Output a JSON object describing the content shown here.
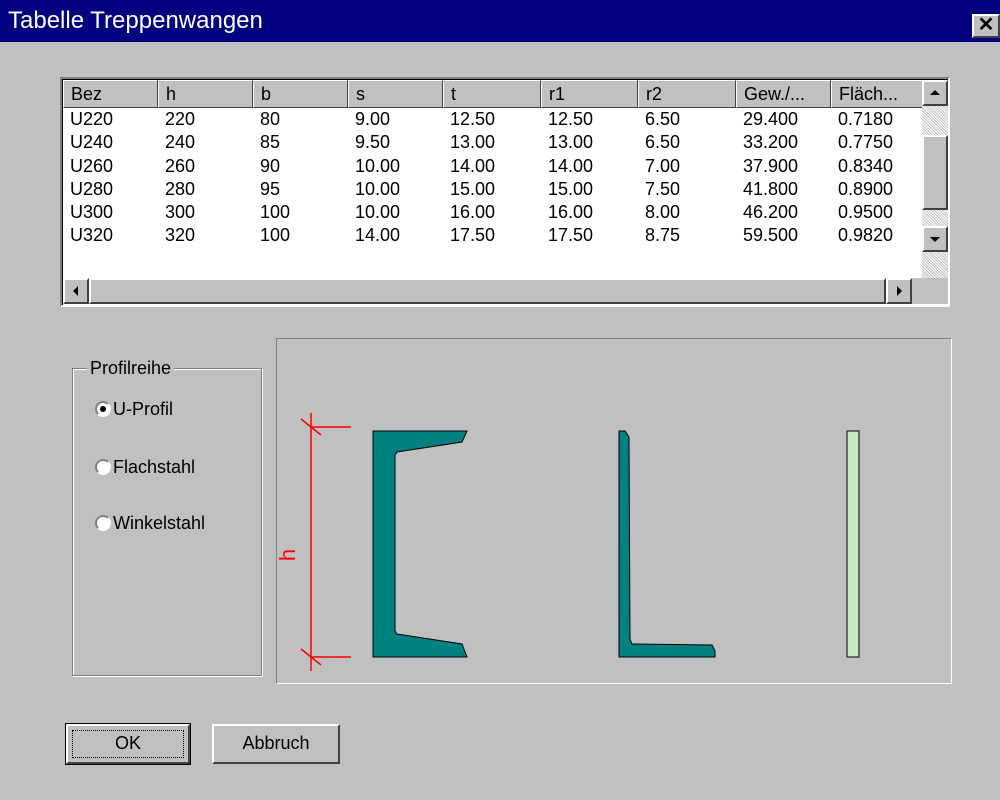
{
  "window": {
    "title": "Tabelle Treppenwangen",
    "close_glyph": "✕"
  },
  "table": {
    "columns": [
      "Bez",
      "h",
      "b",
      "s",
      "t",
      "r1",
      "r2",
      "Gew./...",
      "Fläch..."
    ],
    "rows": [
      [
        "U220",
        "220",
        "80",
        "9.00",
        "12.50",
        "12.50",
        "6.50",
        "29.400",
        "0.7180"
      ],
      [
        "U240",
        "240",
        "85",
        "9.50",
        "13.00",
        "13.00",
        "6.50",
        "33.200",
        "0.7750"
      ],
      [
        "U260",
        "260",
        "90",
        "10.00",
        "14.00",
        "14.00",
        "7.00",
        "37.900",
        "0.8340"
      ],
      [
        "U280",
        "280",
        "95",
        "10.00",
        "15.00",
        "15.00",
        "7.50",
        "41.800",
        "0.8900"
      ],
      [
        "U300",
        "300",
        "100",
        "10.00",
        "16.00",
        "16.00",
        "8.00",
        "46.200",
        "0.9500"
      ],
      [
        "U320",
        "320",
        "100",
        "14.00",
        "17.50",
        "17.50",
        "8.75",
        "59.500",
        "0.9820"
      ]
    ]
  },
  "profilreihe": {
    "title": "Profilreihe",
    "options": [
      {
        "label": "U-Profil",
        "selected": true
      },
      {
        "label": "Flachstahl",
        "selected": false
      },
      {
        "label": "Winkelstahl",
        "selected": false
      }
    ]
  },
  "preview": {
    "dimension_label": "h",
    "profile_color": "#008080",
    "flat_color": "#c8e6c8",
    "dimension_color": "#ff0000"
  },
  "buttons": {
    "ok": "OK",
    "cancel": "Abbruch"
  }
}
